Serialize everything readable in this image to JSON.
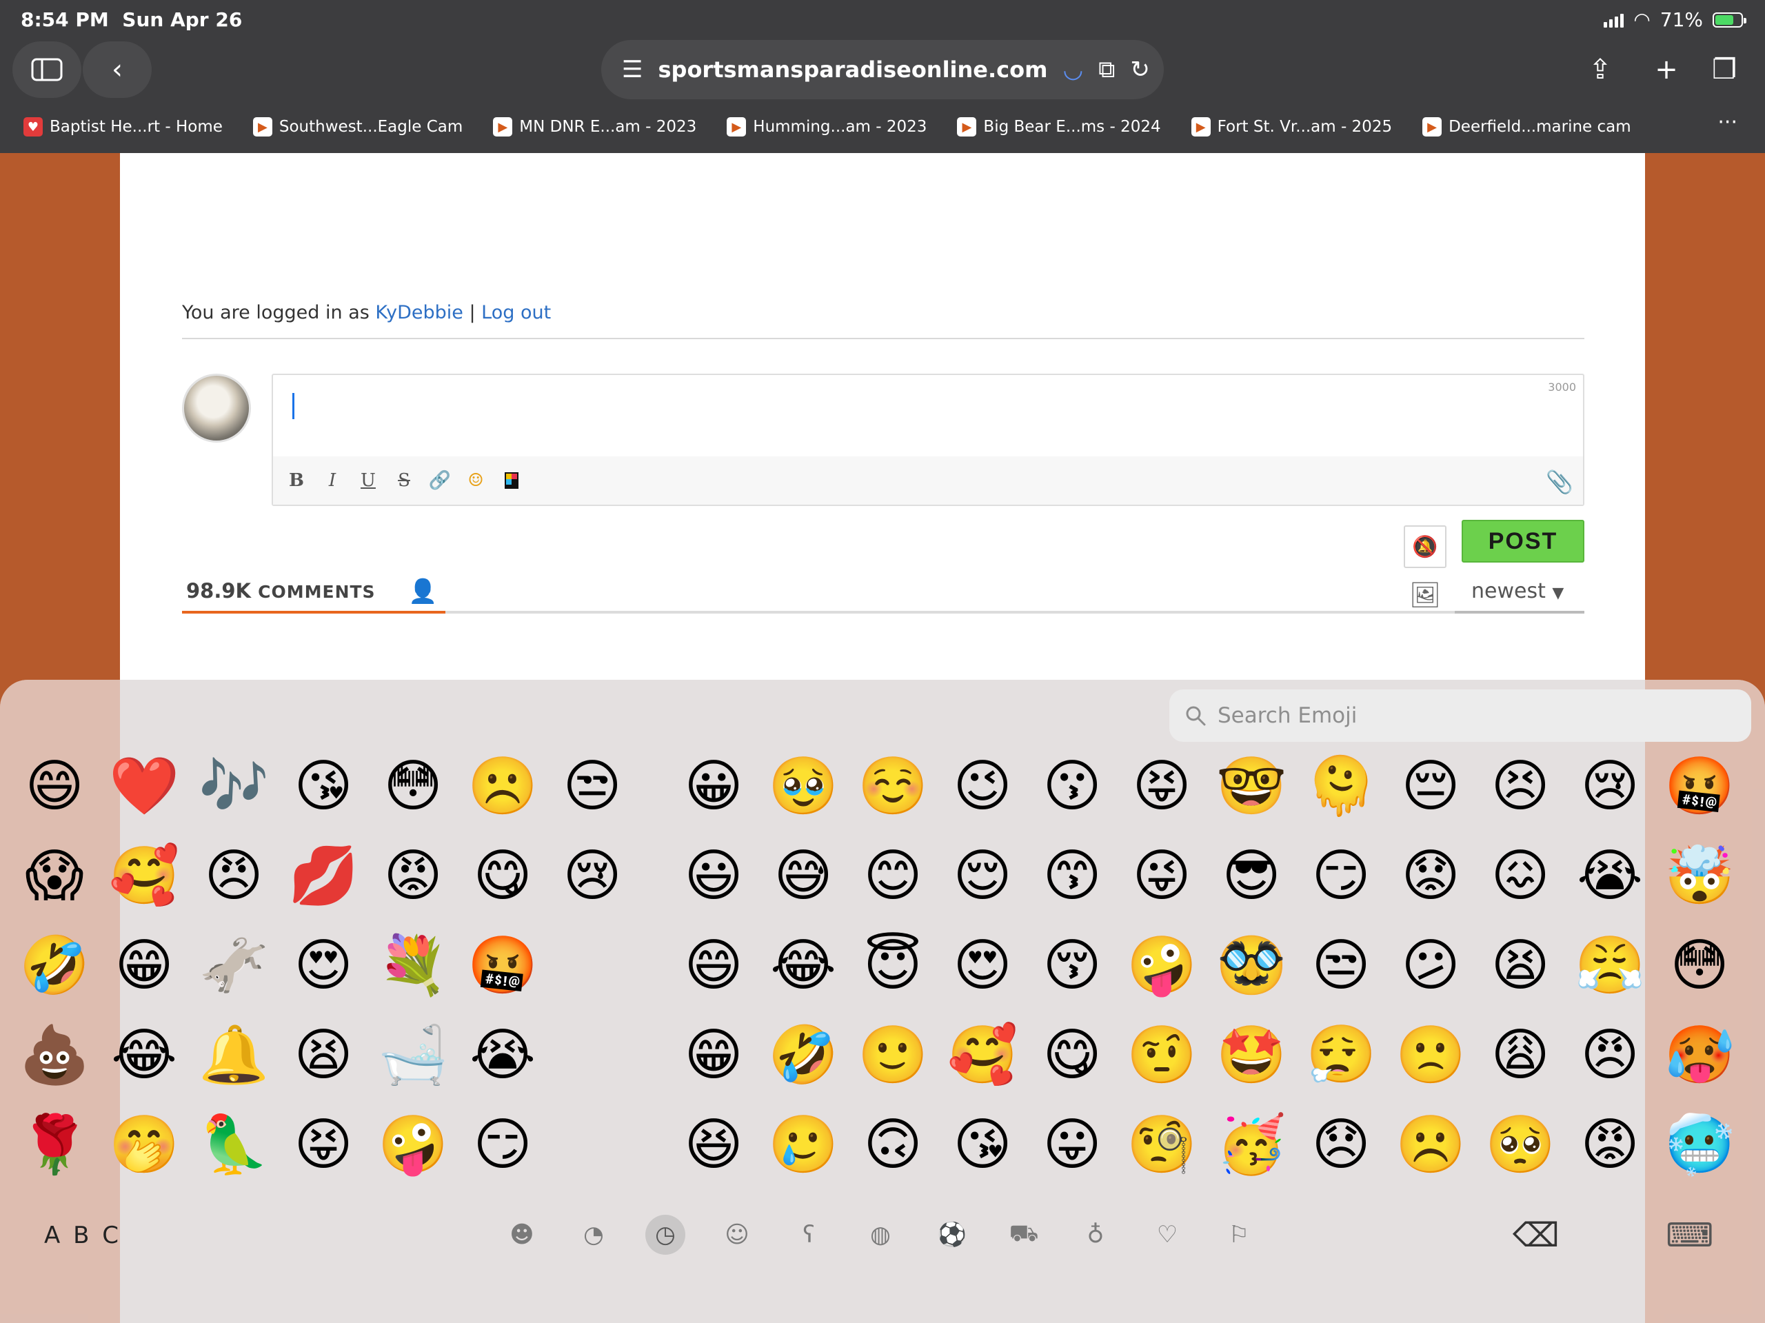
{
  "status": {
    "time": "8:54 PM",
    "date": "Sun Apr 26",
    "battery": "71%"
  },
  "browser": {
    "url": "sportsmansparadiseonline.com",
    "bookmarks": [
      "Baptist He...rt - Home",
      "Southwest...Eagle Cam",
      "MN DNR E...am - 2023",
      "Humming...am - 2023",
      "Big Bear E...ms - 2024",
      "Fort St. Vr...am - 2025",
      "Deerfield...marine cam"
    ]
  },
  "page": {
    "login_prefix": "You are logged in as ",
    "username": "KyDebbie",
    "separator": " | ",
    "logout": "Log out",
    "char_limit": "3000",
    "post_label": "POST",
    "comment_count": "98.9K",
    "comments_label": "COMMENTS",
    "sort_value": "newest"
  },
  "emoji_keyboard": {
    "search_placeholder": "Search Emoji",
    "abc_label": "A B C",
    "recent": [
      "😄",
      "❤️",
      "🎶",
      "😘",
      "😳",
      "☹️",
      "😒",
      "😱",
      "🥰",
      "😠",
      "💋",
      "😡",
      "😋",
      "😢",
      "🤣",
      "😁",
      "🫏",
      "😍",
      "💐",
      "🤬",
      "",
      "💩",
      "😂",
      "🔔",
      "😫",
      "🛁",
      "😭",
      "",
      "🌹",
      "🤭",
      "🦜",
      "😝",
      "🤪",
      "😏",
      ""
    ],
    "smileys": [
      "😀",
      "🥹",
      "☺️",
      "😉",
      "😗",
      "😝",
      "🤓",
      "🫠",
      "😔",
      "😣",
      "😢",
      "🤬",
      "😃",
      "😅",
      "😊",
      "😌",
      "😙",
      "😜",
      "😎",
      "😏",
      "😟",
      "😖",
      "😭",
      "🤯",
      "😄",
      "😂",
      "😇",
      "😍",
      "😚",
      "🤪",
      "🥸",
      "😒",
      "😕",
      "😫",
      "😤",
      "😳",
      "😁",
      "🤣",
      "🙂",
      "🥰",
      "😋",
      "🤨",
      "🤩",
      "😮‍💨",
      "🙁",
      "😩",
      "😠",
      "🥵",
      "😆",
      "🥲",
      "🙃",
      "😘",
      "😛",
      "🧐",
      "🥳",
      "😞",
      "☹️",
      "🥺",
      "😡",
      "🥶"
    ]
  }
}
